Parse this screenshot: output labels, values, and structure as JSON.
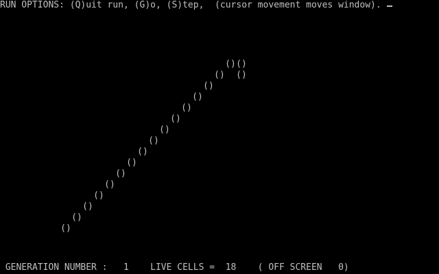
{
  "top_bar": {
    "prompt": "RUN OPTIONS: (Q)uit run, (G)o, (S)tep,  (cursor movement moves window)."
  },
  "cell_glyph": "()",
  "cells": [
    {
      "col": 41,
      "row": 5
    },
    {
      "col": 43,
      "row": 5
    },
    {
      "col": 39,
      "row": 6
    },
    {
      "col": 43,
      "row": 6
    },
    {
      "col": 37,
      "row": 7
    },
    {
      "col": 35,
      "row": 8
    },
    {
      "col": 33,
      "row": 9
    },
    {
      "col": 31,
      "row": 10
    },
    {
      "col": 29,
      "row": 11
    },
    {
      "col": 27,
      "row": 12
    },
    {
      "col": 25,
      "row": 13
    },
    {
      "col": 23,
      "row": 14
    },
    {
      "col": 21,
      "row": 15
    },
    {
      "col": 19,
      "row": 16
    },
    {
      "col": 17,
      "row": 17
    },
    {
      "col": 15,
      "row": 18
    },
    {
      "col": 13,
      "row": 19
    },
    {
      "col": 11,
      "row": 20
    }
  ],
  "status_bar": {
    "text": " GENERATION NUMBER :   1    LIVE CELLS =  18    ( OFF SCREEN   0)"
  },
  "colors": {
    "background": "#000000",
    "text": "#c0c0c0"
  }
}
